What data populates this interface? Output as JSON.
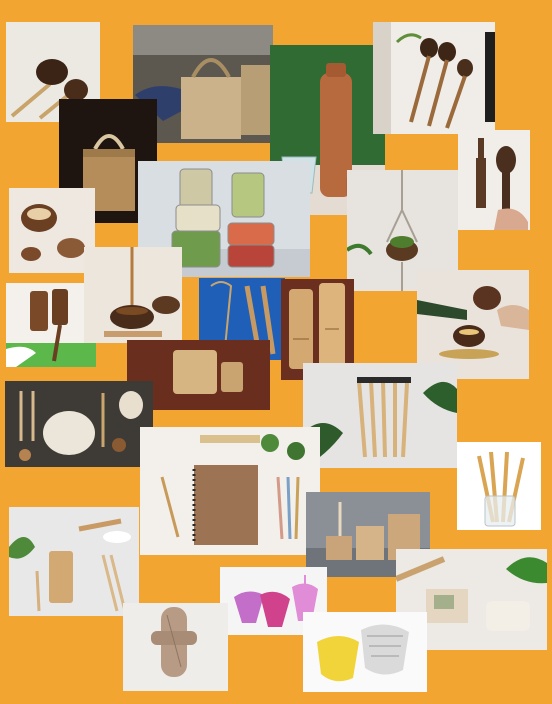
{
  "collage": {
    "background_color": "#F2A530",
    "photos": [
      "coconut-shell-ladles",
      "jute-shopping-bag",
      "hammered-copper-bottle",
      "coconut-shell-spoons",
      "jute-gift-bag",
      "glass-meal-prep-jars",
      "coconut-wood-fork-spoon",
      "coconut-shell-bowls",
      "hanging-macrame-planter",
      "wooden-combs",
      "coconut-shell-cups",
      "copper-tongue-cleaner-bamboo-toothbrushes",
      "neem-wood-combs",
      "coconut-shell-candle",
      "zero-waste-essentials-flatlay",
      "neem-comb-on-leather",
      "bamboo-toothbrushes-with-leaf",
      "kraft-notebook-stationery",
      "bamboo-straws-in-glass",
      "wooden-cutlery-and-cotton-buds",
      "kraft-food-containers",
      "natural-soap-bars",
      "menstrual-cups",
      "cloth-sanitary-pad",
      "cloth-diapers"
    ]
  }
}
